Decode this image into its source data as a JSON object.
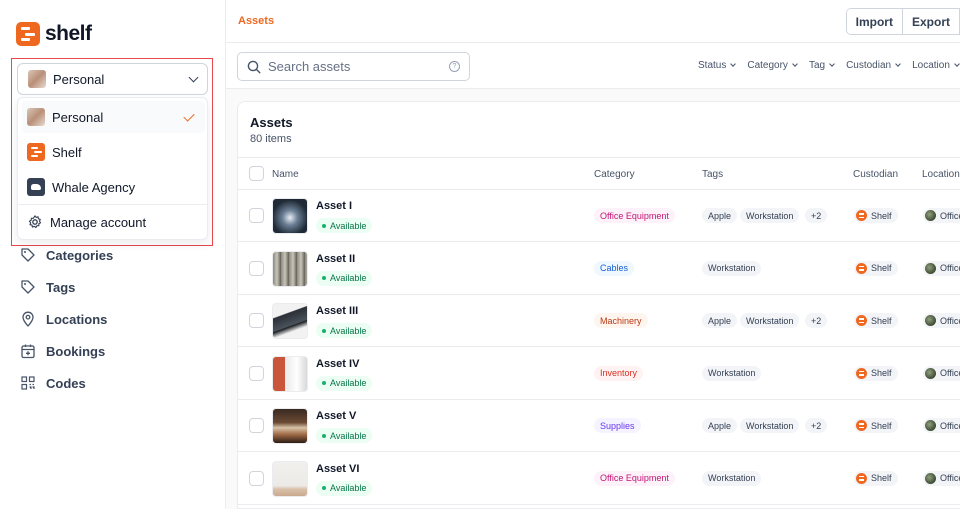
{
  "brand": {
    "name": "shelf",
    "accent": "#ef6820"
  },
  "workspace": {
    "selected": "Personal",
    "options": [
      {
        "label": "Personal",
        "icon": "avatar",
        "selected": true
      },
      {
        "label": "Shelf",
        "icon": "shelf-logo-icon",
        "selected": false
      },
      {
        "label": "Whale Agency",
        "icon": "whale-icon",
        "selected": false
      }
    ],
    "manage_label": "Manage account"
  },
  "sidebar": {
    "items": [
      {
        "label": "Categories",
        "icon": "tag-icon"
      },
      {
        "label": "Tags",
        "icon": "tag-icon"
      },
      {
        "label": "Locations",
        "icon": "map-pin-icon"
      },
      {
        "label": "Bookings",
        "icon": "calendar-plus-icon"
      },
      {
        "label": "Codes",
        "icon": "qr-code-icon"
      }
    ]
  },
  "header": {
    "breadcrumb": "Assets",
    "import_label": "Import",
    "export_label": "Export"
  },
  "search": {
    "placeholder": "Search assets",
    "help": "?"
  },
  "filters": [
    "Status",
    "Category",
    "Tag",
    "Custodian",
    "Location"
  ],
  "table": {
    "title": "Assets",
    "count": "80 items",
    "columns": [
      "Name",
      "Category",
      "Tags",
      "Custodian",
      "Location"
    ],
    "rows": [
      {
        "name": "Asset I",
        "status": "Available",
        "category": "Office Equipment",
        "category_color": "pink",
        "tags": [
          "Apple",
          "Workstation",
          "+2"
        ],
        "custodian": "Shelf",
        "location": "Office"
      },
      {
        "name": "Asset II",
        "status": "Available",
        "category": "Cables",
        "category_color": "blue",
        "tags": [
          "Workstation"
        ],
        "custodian": "Shelf",
        "location": "Office"
      },
      {
        "name": "Asset III",
        "status": "Available",
        "category": "Machinery",
        "category_color": "orange",
        "tags": [
          "Apple",
          "Workstation",
          "+2"
        ],
        "custodian": "Shelf",
        "location": "Office"
      },
      {
        "name": "Asset IV",
        "status": "Available",
        "category": "Inventory",
        "category_color": "red",
        "tags": [
          "Workstation"
        ],
        "custodian": "Shelf",
        "location": "Office"
      },
      {
        "name": "Asset V",
        "status": "Available",
        "category": "Supplies",
        "category_color": "purple",
        "tags": [
          "Apple",
          "Workstation",
          "+2"
        ],
        "custodian": "Shelf",
        "location": "Office"
      },
      {
        "name": "Asset VI",
        "status": "Available",
        "category": "Office Equipment",
        "category_color": "pink",
        "tags": [
          "Workstation"
        ],
        "custodian": "Shelf",
        "location": "Office"
      }
    ]
  }
}
